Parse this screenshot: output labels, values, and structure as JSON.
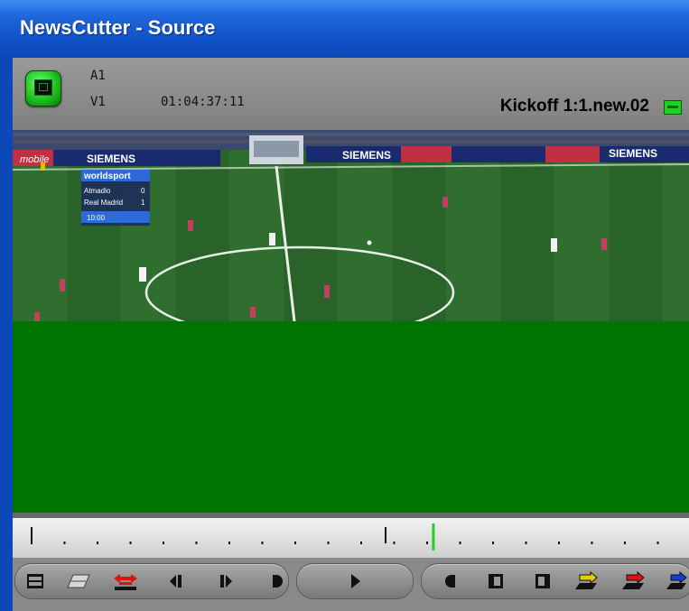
{
  "window": {
    "title": "NewsCutter - Source"
  },
  "monitor": {
    "tracks": {
      "audio": "A1",
      "video": "V1"
    },
    "timecode": "01:04:37:11",
    "clip_name": "Kickoff 1:1.new.02"
  },
  "overlay": {
    "brand": "worldsport",
    "team1": "Atmadio",
    "score1": "0",
    "team2": "Real Madrid",
    "score2": "1",
    "clock": "10:00"
  },
  "ads": [
    "SIEMENS",
    "mobile",
    "SIEMENS",
    "SIEMENS"
  ],
  "timeline": {
    "position_fraction": 0.62
  },
  "colors": {
    "title_bar": "#0f52c8",
    "accent_green": "#1fd21f",
    "mark_red": "#e01010",
    "mark_yellow": "#e8d000",
    "mark_blue": "#1040d0"
  },
  "controls": [
    {
      "icon": "toggle-monitor-icon"
    },
    {
      "icon": "match-frame-icon"
    },
    {
      "icon": "mark-clip-icon"
    },
    {
      "icon": "step-back-icon"
    },
    {
      "icon": "step-forward-icon"
    },
    {
      "icon": "play-out-icon"
    },
    {
      "icon": "play-icon"
    },
    {
      "icon": "mark-in-icon"
    },
    {
      "icon": "go-to-in-icon"
    },
    {
      "icon": "go-to-out-icon"
    },
    {
      "icon": "splice-in-icon"
    },
    {
      "icon": "overwrite-icon"
    },
    {
      "icon": "replace-icon"
    }
  ]
}
